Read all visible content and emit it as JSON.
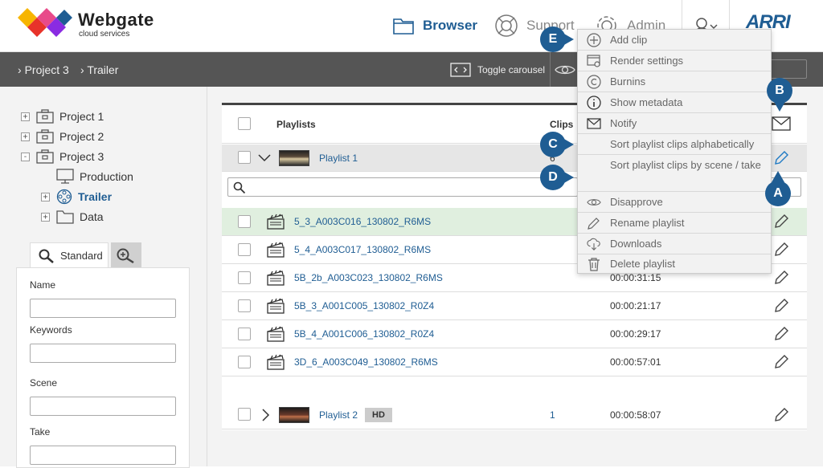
{
  "header": {
    "brand": "Webgate",
    "brand_sub": "cloud services",
    "nav": {
      "browser": "Browser",
      "support": "Support",
      "admin": "Admin"
    },
    "partner_logo": "ARRI"
  },
  "breadcrumb": {
    "items": [
      "Project 3",
      "Trailer"
    ],
    "toggle_carousel": "Toggle carousel"
  },
  "tree": {
    "items": [
      {
        "label": "Project 1",
        "expander": "+",
        "icon": "briefcase-icon"
      },
      {
        "label": "Project 2",
        "expander": "+",
        "icon": "briefcase-icon"
      },
      {
        "label": "Project 3",
        "expander": "-",
        "icon": "briefcase-icon"
      },
      {
        "label": "Production",
        "expander": "",
        "icon": "monitor-icon"
      },
      {
        "label": "Trailer",
        "expander": "+",
        "icon": "film-reel-icon"
      },
      {
        "label": "Data",
        "expander": "+",
        "icon": "folder-icon"
      }
    ]
  },
  "search": {
    "tab_standard": "Standard",
    "fields": [
      {
        "label": "Name",
        "value": ""
      },
      {
        "label": "Keywords",
        "value": ""
      },
      {
        "label": "Scene",
        "value": ""
      },
      {
        "label": "Take",
        "value": ""
      }
    ]
  },
  "table": {
    "header_playlists": "Playlists",
    "header_clips": "Clips",
    "playlists": [
      {
        "name": "Playlist 1",
        "clips": "6",
        "duration": "",
        "badge": ""
      },
      {
        "name": "Playlist 2",
        "clips": "1",
        "duration": "00:00:58:07",
        "badge": "HD"
      }
    ],
    "clips": [
      {
        "name": "5_3_A003C016_130802_R6MS",
        "duration": ""
      },
      {
        "name": "5_4_A003C017_130802_R6MS",
        "duration": ""
      },
      {
        "name": "5B_2b_A003C023_130802_R6MS",
        "duration": "00:00:31:15"
      },
      {
        "name": "5B_3_A001C005_130802_R0Z4",
        "duration": "00:00:21:17"
      },
      {
        "name": "5B_4_A001C006_130802_R0Z4",
        "duration": "00:00:29:17"
      },
      {
        "name": "3D_6_A003C049_130802_R6MS",
        "duration": "00:00:57:01"
      }
    ]
  },
  "menu": {
    "items": [
      {
        "label": "Add clip",
        "icon": "plus-circle-icon"
      },
      {
        "label": "Render settings",
        "icon": "render-settings-icon"
      },
      {
        "label": "Burnins",
        "icon": "copyright-icon"
      },
      {
        "label": "Show metadata",
        "icon": "info-icon"
      },
      {
        "label": "Notify",
        "icon": "envelope-icon"
      },
      {
        "label": "Sort playlist clips alphabetically",
        "icon": ""
      },
      {
        "label": "Sort playlist clips by scene / take",
        "icon": ""
      },
      {
        "label": "Disapprove",
        "icon": "eye-icon"
      },
      {
        "label": "Rename playlist",
        "icon": "pencil-icon"
      },
      {
        "label": "Downloads",
        "icon": "cloud-download-icon"
      },
      {
        "label": "Delete playlist",
        "icon": "trash-icon"
      }
    ]
  },
  "callouts": {
    "a": "A",
    "b": "B",
    "c": "C",
    "d": "D",
    "e": "E"
  },
  "colors": {
    "accent": "#1f5d93",
    "highlight_row": "#e0efdf",
    "crumb_bar": "#555555"
  }
}
